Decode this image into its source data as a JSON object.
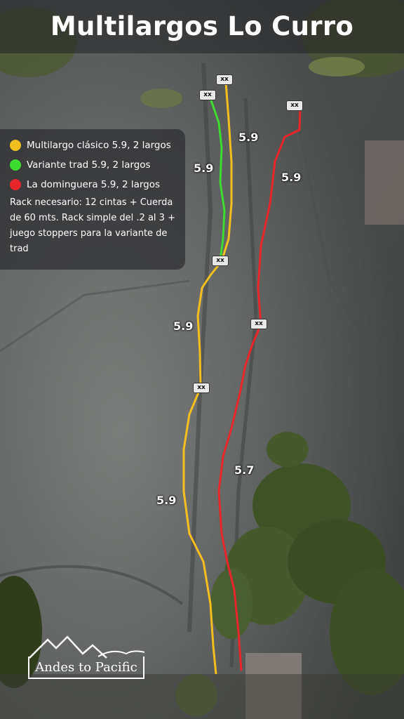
{
  "title": "Multilargos Lo Curro",
  "legend": {
    "routes": [
      {
        "label": "Multilargo clásico 5.9, 2 largos",
        "color": "#f2c01e"
      },
      {
        "label": "Variante trad 5.9, 2 largos",
        "color": "#3ddc2e"
      },
      {
        "label": "La dominguera 5.9, 2 largos",
        "color": "#e8262c"
      }
    ],
    "rack": "Rack necesario: 12 cintas + Cuerda de 60 mts. Rack simple del .2 al 3 + juego stoppers para la variante de trad"
  },
  "grades": [
    "5.9",
    "5.9",
    "5.9",
    "5.9",
    "5.9",
    "5.7"
  ],
  "anchor_label": "xx",
  "logo": {
    "text": "Andes to Pacific"
  }
}
